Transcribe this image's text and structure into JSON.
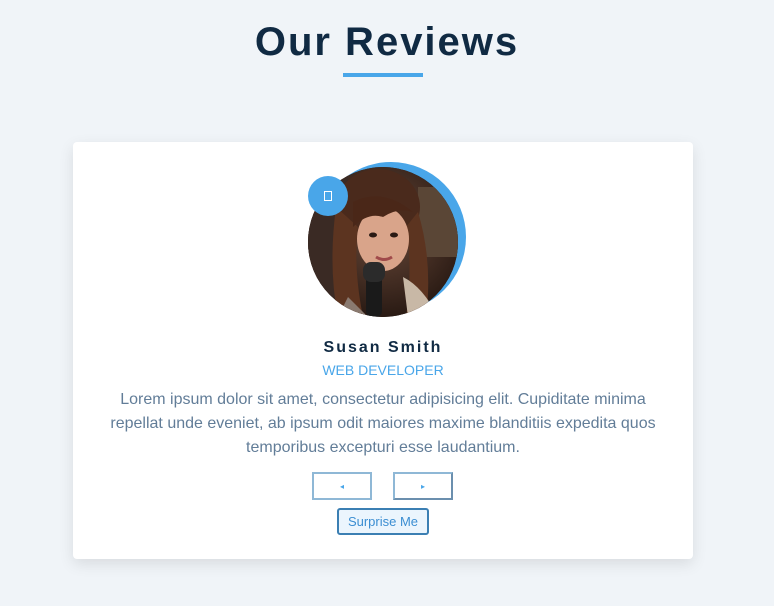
{
  "page": {
    "title": "Our Reviews"
  },
  "review": {
    "author": "Susan Smith",
    "job": "WEB DEVELOPER",
    "text": "Lorem ipsum dolor sit amet, consectetur adipisicing elit. Cupiditate minima repellat unde eveniet, ab ipsum odit maiores maxime blanditiis expedita quos temporibus excepturi esse laudantium.",
    "quote_icon": "quote-icon"
  },
  "controls": {
    "prev_label": "◂",
    "prev_icon": "chevron-left-icon",
    "next_label": "▸",
    "next_icon": "chevron-right-icon",
    "surprise_label": "Surprise Me"
  },
  "colors": {
    "accent": "#49a6e9",
    "title": "#102a43",
    "text": "#627d98",
    "background": "#f0f4f8"
  }
}
